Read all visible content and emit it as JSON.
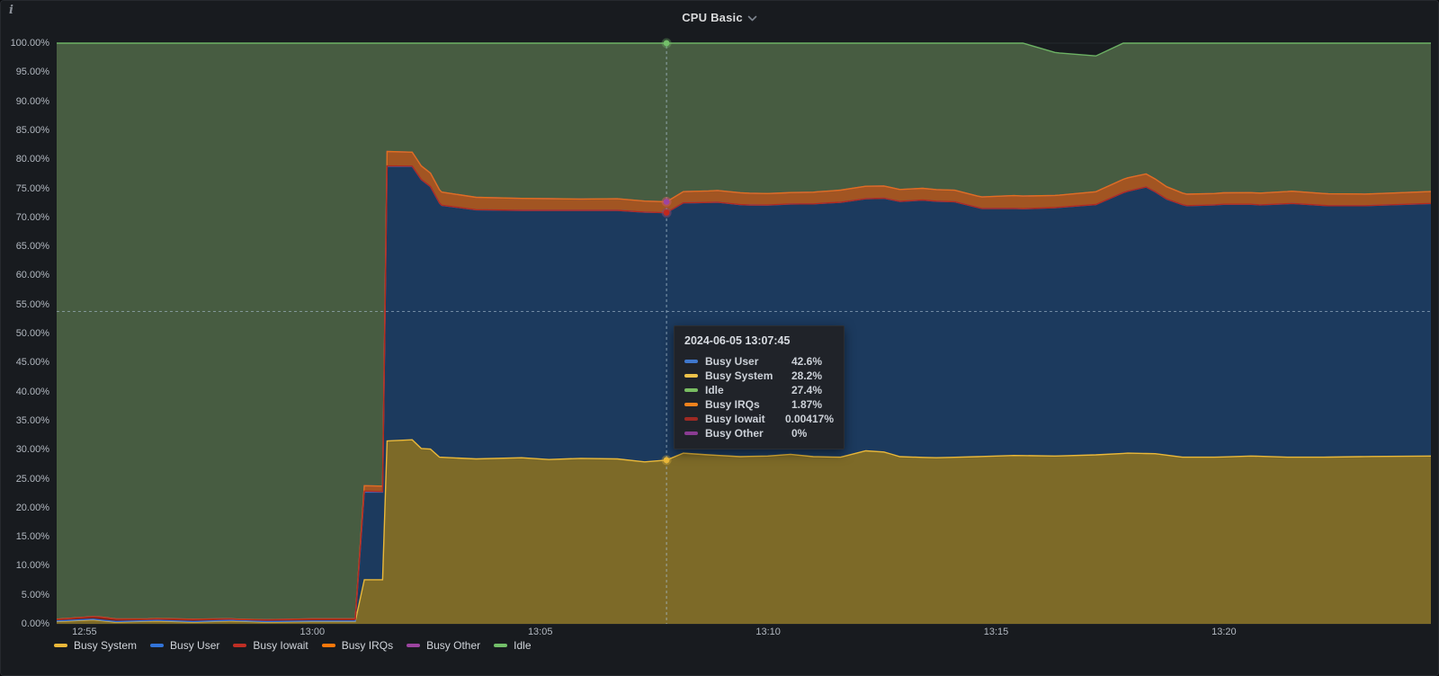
{
  "panel": {
    "title": "CPU Basic",
    "info_icon": "i"
  },
  "tooltip": {
    "title": "2024-06-05 13:07:45",
    "rows": [
      {
        "label": "Busy User",
        "value": "42.6%",
        "color": "#3f77cc"
      },
      {
        "label": "Busy System",
        "value": "28.2%",
        "color": "#edc24a"
      },
      {
        "label": "Idle",
        "value": "27.4%",
        "color": "#79bd62"
      },
      {
        "label": "Busy IRQs",
        "value": "1.87%",
        "color": "#f2821c"
      },
      {
        "label": "Busy Iowait",
        "value": "0.00417%",
        "color": "#9e2a23"
      },
      {
        "label": "Busy Other",
        "value": "0%",
        "color": "#8a3c92"
      }
    ]
  },
  "legend": {
    "items": [
      {
        "label": "Busy System",
        "color": "#EAB839"
      },
      {
        "label": "Busy User",
        "color": "#3274D9"
      },
      {
        "label": "Busy Iowait",
        "color": "#bf2e24"
      },
      {
        "label": "Busy IRQs",
        "color": "#FF780A"
      },
      {
        "label": "Busy Other",
        "color": "#9c44a0"
      },
      {
        "label": "Idle",
        "color": "#73BF69"
      }
    ]
  },
  "chart_data": {
    "type": "area",
    "stacked": true,
    "title": "CPU Basic",
    "ylabel": "",
    "xlabel": "",
    "ylim": [
      0,
      100
    ],
    "grid": true,
    "legend_position": "bottom",
    "y_ticks": [
      "100.00%",
      "95.00%",
      "90.00%",
      "85.00%",
      "80.00%",
      "75.00%",
      "70.00%",
      "65.00%",
      "60.00%",
      "55.00%",
      "50.00%",
      "45.00%",
      "40.00%",
      "35.00%",
      "30.00%",
      "25.00%",
      "20.00%",
      "15.00%",
      "10.00%",
      "5.00%",
      "0.00%"
    ],
    "x_ticks": [
      {
        "label": "12:55",
        "t": 0.61
      },
      {
        "label": "13:00",
        "t": 5.61
      },
      {
        "label": "13:05",
        "t": 10.61
      },
      {
        "label": "13:10",
        "t": 15.61
      },
      {
        "label": "13:15",
        "t": 20.61
      },
      {
        "label": "13:20",
        "t": 25.61
      }
    ],
    "crosshair": {
      "time": "2024-06-05 13:07:45",
      "t_minutes": 13.38,
      "horizontal_percent": 53.8
    },
    "series": [
      {
        "key": "system",
        "name": "Busy System",
        "line": "#EAB839",
        "fill": "#7d6a28",
        "points": [
          [
            0,
            0.4
          ],
          [
            0.8,
            0.7
          ],
          [
            1.3,
            0.3
          ],
          [
            2.2,
            0.5
          ],
          [
            3,
            0.3
          ],
          [
            3.8,
            0.5
          ],
          [
            4.6,
            0.3
          ],
          [
            5.6,
            0.4
          ],
          [
            6.55,
            0.4
          ],
          [
            6.75,
            7.6
          ],
          [
            7.15,
            7.6
          ],
          [
            7.25,
            31.5
          ],
          [
            7.8,
            31.7
          ],
          [
            8.0,
            30.2
          ],
          [
            8.2,
            30.1
          ],
          [
            8.4,
            28.7
          ],
          [
            9.2,
            28.4
          ],
          [
            10.2,
            28.6
          ],
          [
            10.8,
            28.3
          ],
          [
            11.5,
            28.5
          ],
          [
            12.3,
            28.4
          ],
          [
            12.9,
            27.9
          ],
          [
            13.38,
            28.2
          ],
          [
            13.75,
            29.4
          ],
          [
            14.3,
            29.1
          ],
          [
            15,
            28.8
          ],
          [
            15.6,
            28.9
          ],
          [
            16.1,
            29.2
          ],
          [
            16.6,
            28.8
          ],
          [
            17.2,
            28.7
          ],
          [
            17.75,
            29.8
          ],
          [
            18.15,
            29.6
          ],
          [
            18.5,
            28.8
          ],
          [
            19.3,
            28.6
          ],
          [
            20.2,
            28.8
          ],
          [
            21,
            29.0
          ],
          [
            21.9,
            28.9
          ],
          [
            22.8,
            29.1
          ],
          [
            23.5,
            29.4
          ],
          [
            24.1,
            29.3
          ],
          [
            24.7,
            28.7
          ],
          [
            25.4,
            28.7
          ],
          [
            26.2,
            28.9
          ],
          [
            27,
            28.7
          ],
          [
            27.8,
            28.7
          ],
          [
            28.6,
            28.8
          ],
          [
            30.2,
            28.9
          ]
        ]
      },
      {
        "key": "user",
        "name": "Busy User",
        "line": "#3274D9",
        "fill": "#1c3a5e",
        "points": [
          [
            0,
            0.1
          ],
          [
            6.55,
            0.1
          ],
          [
            6.75,
            15.1
          ],
          [
            7.15,
            15.1
          ],
          [
            7.25,
            47.3
          ],
          [
            7.8,
            47.1
          ],
          [
            8.0,
            46.3
          ],
          [
            8.2,
            45.2
          ],
          [
            8.45,
            43.4
          ],
          [
            9.2,
            42.9
          ],
          [
            10.2,
            42.6
          ],
          [
            10.8,
            42.9
          ],
          [
            11.5,
            42.7
          ],
          [
            12.3,
            42.8
          ],
          [
            12.9,
            43.0
          ],
          [
            13.38,
            42.6
          ],
          [
            13.75,
            43.1
          ],
          [
            14.5,
            43.6
          ],
          [
            15.2,
            43.3
          ],
          [
            16.1,
            43.1
          ],
          [
            16.7,
            43.6
          ],
          [
            17.2,
            43.9
          ],
          [
            17.75,
            43.4
          ],
          [
            18.3,
            43.8
          ],
          [
            19,
            44.3
          ],
          [
            19.7,
            44.0
          ],
          [
            20.3,
            42.7
          ],
          [
            21.2,
            42.5
          ],
          [
            22,
            42.8
          ],
          [
            22.8,
            43.1
          ],
          [
            23.4,
            44.9
          ],
          [
            23.9,
            45.9
          ],
          [
            24.35,
            44.1
          ],
          [
            24.8,
            43.3
          ],
          [
            25.6,
            43.5
          ],
          [
            26.4,
            43.3
          ],
          [
            27.1,
            43.7
          ],
          [
            27.9,
            43.3
          ],
          [
            28.7,
            43.2
          ],
          [
            30.2,
            43.5
          ]
        ]
      },
      {
        "key": "iowait",
        "name": "Busy Iowait",
        "line": "#b2281e",
        "fill": "#6b221c",
        "points": [
          [
            0,
            0.25
          ],
          [
            1,
            0.45
          ],
          [
            2,
            0.25
          ],
          [
            3,
            0.35
          ],
          [
            4,
            0.2
          ],
          [
            5,
            0.3
          ],
          [
            6.55,
            0.3
          ],
          [
            6.75,
            0.15
          ],
          [
            7.25,
            0.05
          ],
          [
            8,
            0.01
          ],
          [
            30.2,
            0.005
          ]
        ]
      },
      {
        "key": "irqs",
        "name": "Busy IRQs",
        "line": "#e0701d",
        "fill": "#a25522",
        "points": [
          [
            0,
            0.05
          ],
          [
            6.55,
            0.05
          ],
          [
            6.75,
            0.95
          ],
          [
            7.15,
            0.95
          ],
          [
            7.25,
            2.5
          ],
          [
            7.8,
            2.4
          ],
          [
            8.2,
            2.3
          ],
          [
            9.2,
            2.15
          ],
          [
            10.2,
            2.05
          ],
          [
            11.5,
            1.95
          ],
          [
            12.3,
            2.0
          ],
          [
            12.9,
            1.9
          ],
          [
            13.38,
            1.87
          ],
          [
            14,
            1.95
          ],
          [
            15,
            2.05
          ],
          [
            16,
            1.95
          ],
          [
            17,
            2.05
          ],
          [
            17.75,
            2.15
          ],
          [
            18.5,
            2.05
          ],
          [
            19.3,
            2.0
          ],
          [
            20.2,
            1.95
          ],
          [
            21,
            2.2
          ],
          [
            22,
            2.1
          ],
          [
            22.8,
            2.2
          ],
          [
            23.5,
            2.3
          ],
          [
            24.1,
            2.2
          ],
          [
            24.7,
            2.0
          ],
          [
            25.4,
            1.95
          ],
          [
            26.2,
            2.0
          ],
          [
            27,
            2.1
          ],
          [
            27.8,
            2.05
          ],
          [
            28.6,
            2.0
          ],
          [
            30.2,
            2.05
          ]
        ]
      },
      {
        "key": "other",
        "name": "Busy Other",
        "line": "#963e96",
        "fill": "#5a2a5e",
        "points": [
          [
            0,
            0
          ],
          [
            30.2,
            0
          ]
        ]
      },
      {
        "key": "idle",
        "name": "Idle",
        "line": "#73BF69",
        "fill": "#475c41",
        "points": [
          [
            0,
            99.2
          ],
          [
            6.55,
            99.2
          ],
          [
            6.75,
            76.2
          ],
          [
            7.15,
            76.2
          ],
          [
            7.25,
            18.7
          ],
          [
            7.8,
            18.8
          ],
          [
            8.45,
            26.0
          ],
          [
            9.2,
            26.5
          ],
          [
            13.38,
            27.4
          ],
          [
            17.75,
            24.5
          ],
          [
            20.3,
            26.8
          ],
          [
            23.9,
            21.9
          ],
          [
            24.8,
            26.6
          ],
          [
            30.2,
            25.5
          ]
        ]
      }
    ]
  }
}
